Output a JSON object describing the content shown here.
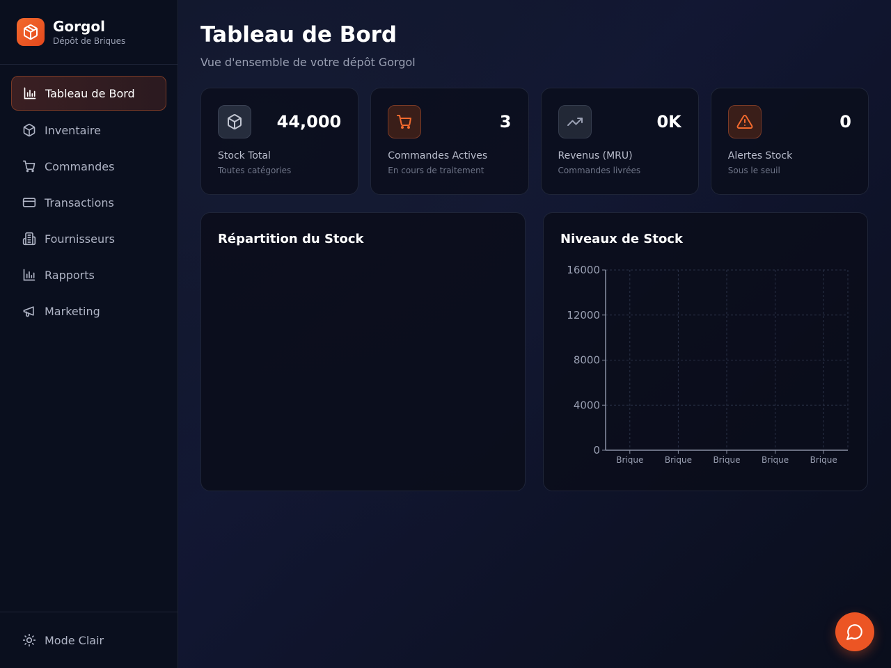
{
  "brand": {
    "name": "Gorgol",
    "subtitle": "Dépôt de Briques"
  },
  "sidebar": {
    "items": [
      {
        "label": "Tableau de Bord",
        "icon": "bar-chart-icon",
        "active": true
      },
      {
        "label": "Inventaire",
        "icon": "package-icon",
        "active": false
      },
      {
        "label": "Commandes",
        "icon": "cart-icon",
        "active": false
      },
      {
        "label": "Transactions",
        "icon": "credit-card-icon",
        "active": false
      },
      {
        "label": "Fournisseurs",
        "icon": "building-icon",
        "active": false
      },
      {
        "label": "Rapports",
        "icon": "bar-chart-icon",
        "active": false
      },
      {
        "label": "Marketing",
        "icon": "megaphone-icon",
        "active": false
      }
    ],
    "footer_label": "Mode Clair"
  },
  "header": {
    "title": "Tableau de Bord",
    "subtitle": "Vue d'ensemble de votre dépôt Gorgol"
  },
  "stats": [
    {
      "value": "44,000",
      "label": "Stock Total",
      "hint": "Toutes catégories",
      "icon": "package-icon"
    },
    {
      "value": "3",
      "label": "Commandes Actives",
      "hint": "En cours de traitement",
      "icon": "cart-icon"
    },
    {
      "value": "0K",
      "label": "Revenus (MRU)",
      "hint": "Commandes livrées",
      "icon": "trending-up-icon"
    },
    {
      "value": "0",
      "label": "Alertes Stock",
      "hint": "Sous le seuil",
      "icon": "alert-triangle-icon"
    }
  ],
  "panels": {
    "distribution_title": "Répartition du Stock",
    "levels_title": "Niveaux de Stock"
  },
  "colors": {
    "accent": "#ec5524",
    "background": "#0c1120"
  },
  "chart_data": {
    "type": "bar",
    "categories": [
      "Brique",
      "Brique",
      "Brique",
      "Brique",
      "Brique"
    ],
    "values": [
      0,
      0,
      0,
      0,
      0
    ],
    "title": "Niveaux de Stock",
    "xlabel": "",
    "ylabel": "",
    "ylim": [
      0,
      16000
    ],
    "yticks": [
      0,
      4000,
      8000,
      12000,
      16000
    ],
    "grid": true
  }
}
